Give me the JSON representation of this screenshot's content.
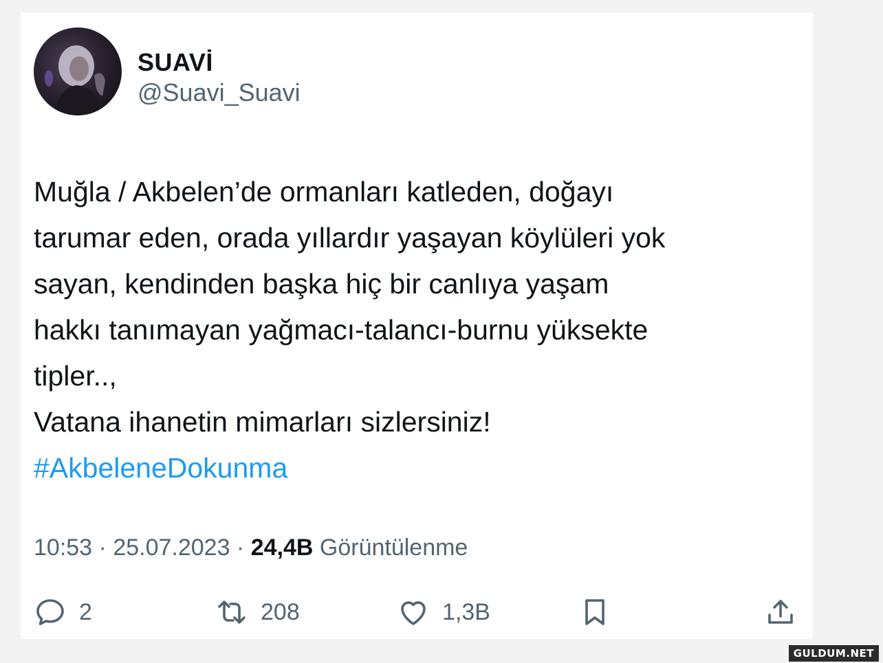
{
  "tweet": {
    "display_name": "SUAVİ",
    "handle": "@Suavi_Suavi",
    "text_lines": [
      "Muğla / Akbelen’de ormanları katleden, doğayı",
      "tarumar eden, orada yıllardır yaşayan köylüleri yok",
      "sayan, kendinden başka hiç bir canlıya yaşam",
      "hakkı tanımayan yağmacı-talancı-burnu yüksekte",
      "tipler..,",
      "Vatana ihanetin mimarları sizlersiniz!"
    ],
    "hashtag": "#AkbeleneDokunma",
    "time": "10:53",
    "date": "25.07.2023",
    "separator": " · ",
    "views_count": "24,4B",
    "views_label": "Görüntülenme"
  },
  "actions": {
    "reply_count": "2",
    "retweet_count": "208",
    "like_count": "1,3B"
  },
  "icons": {
    "reply": "reply-icon",
    "retweet": "retweet-icon",
    "like": "heart-icon",
    "bookmark": "bookmark-icon",
    "share": "share-icon"
  },
  "watermark": "GULDUM.NET",
  "colors": {
    "text": "#0f1419",
    "secondary": "#536471",
    "hashtag": "#1d9bf0"
  }
}
